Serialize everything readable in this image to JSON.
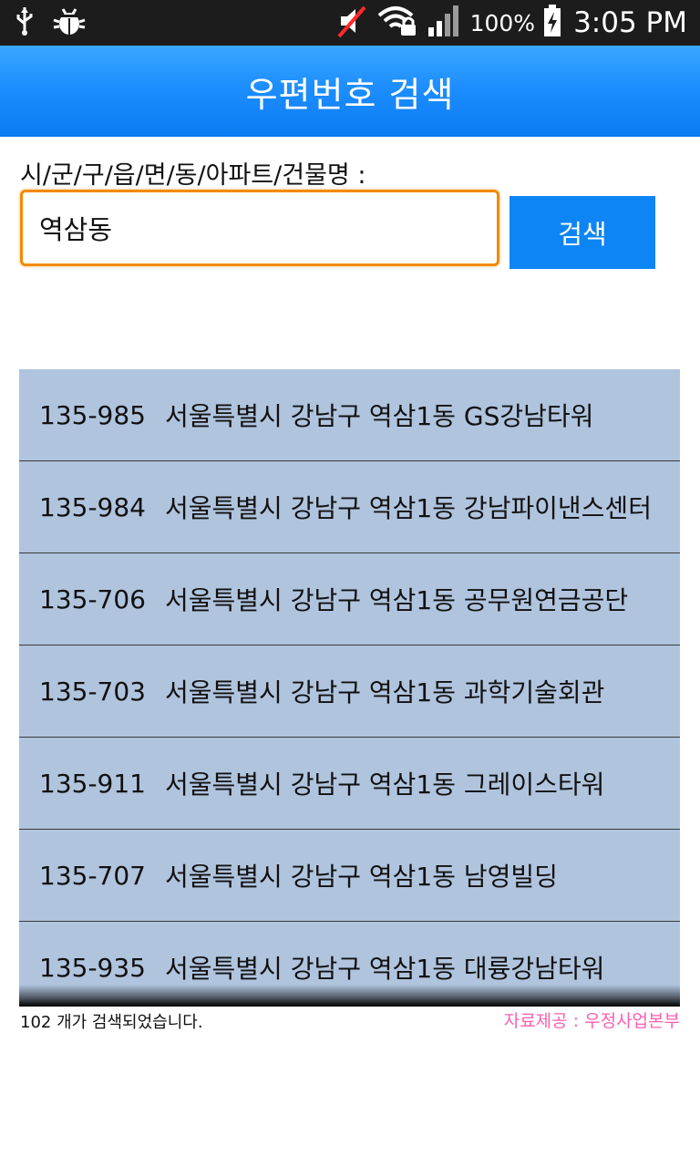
{
  "status_bar": {
    "battery_percent": "100%",
    "time": "3:05 PM",
    "icons": [
      "usb-icon",
      "debug-bug-icon",
      "muted-speaker-icon",
      "wifi-lock-icon",
      "signal-icon",
      "battery-charging-icon"
    ]
  },
  "header": {
    "title": "우편번호 검색"
  },
  "search": {
    "label": "시/군/구/읍/면/동/아파트/건물명 :",
    "value": "역삼동",
    "button_label": "검색"
  },
  "results": [
    {
      "zip": "135-985",
      "address": "서울특별시 강남구 역삼1동 GS강남타워"
    },
    {
      "zip": "135-984",
      "address": "서울특별시 강남구 역삼1동 강남파이낸스센터"
    },
    {
      "zip": "135-706",
      "address": "서울특별시 강남구 역삼1동 공무원연금공단"
    },
    {
      "zip": "135-703",
      "address": "서울특별시 강남구 역삼1동 과학기술회관"
    },
    {
      "zip": "135-911",
      "address": "서울특별시 강남구 역삼1동 그레이스타워"
    },
    {
      "zip": "135-707",
      "address": "서울특별시 강남구 역삼1동 남영빌딩"
    },
    {
      "zip": "135-935",
      "address": "서울특별시 강남구 역삼1동 대륭강남타워"
    }
  ],
  "footer": {
    "count_text": "102 개가 검색되었습니다.",
    "source_text": "자료제공 : 우정사업본부"
  },
  "colors": {
    "title_bar": "#1d8eff",
    "search_button": "#0e85f5",
    "input_border": "#f18a00",
    "list_background": "#b0c4de",
    "source_text": "#ff5fb0"
  }
}
